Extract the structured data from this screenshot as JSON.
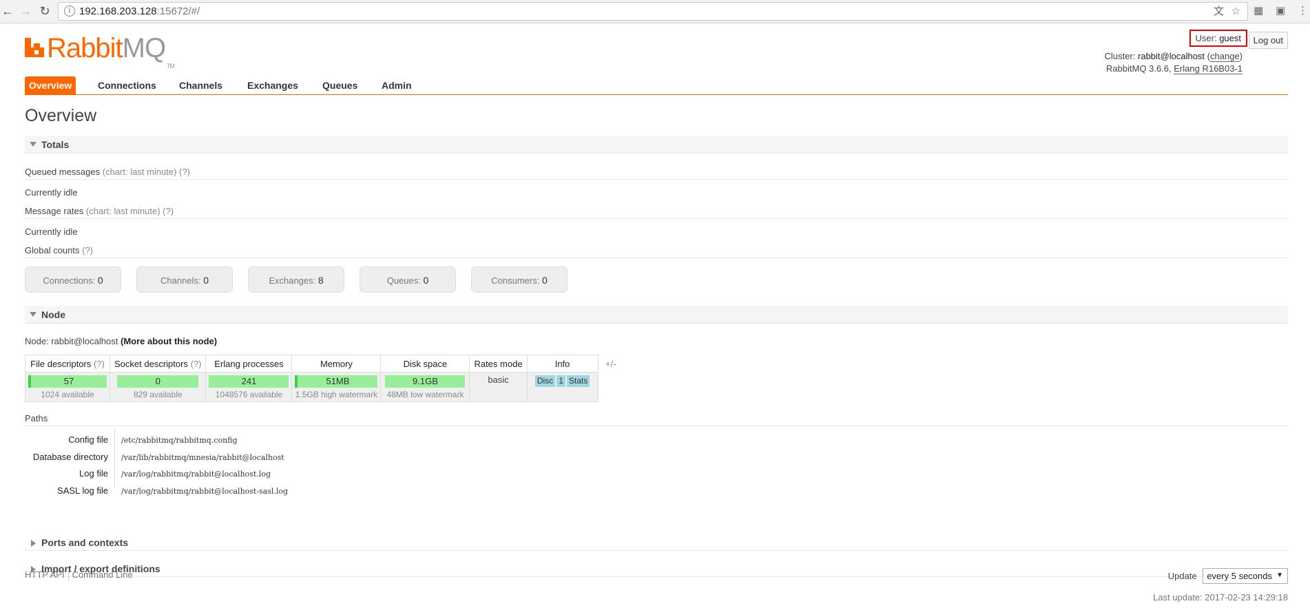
{
  "browser": {
    "url_host": "192.168.203.128",
    "url_rest": ":15672/#/"
  },
  "logo": {
    "rabbit": "Rabbit",
    "mq": "MQ",
    "tm": "TM"
  },
  "header": {
    "user_label": "User:",
    "user_value": "guest",
    "logout_label": "Log out",
    "cluster_label": "Cluster:",
    "cluster_value": "rabbit@localhost",
    "change_label": "change",
    "version_text": "RabbitMQ 3.6.6,",
    "erlang_label": "Erlang R16B03-1"
  },
  "tabs": [
    {
      "label": "Overview",
      "active": true
    },
    {
      "label": "Connections"
    },
    {
      "label": "Channels"
    },
    {
      "label": "Exchanges"
    },
    {
      "label": "Queues"
    },
    {
      "label": "Admin"
    }
  ],
  "page_title": "Overview",
  "totals": {
    "title": "Totals",
    "queued_messages": "Queued messages",
    "queued_hint": "(chart: last minute) (?)",
    "idle_1": "Currently idle",
    "message_rates": "Message rates",
    "rates_hint": "(chart: last minute) (?)",
    "idle_2": "Currently idle",
    "global_counts": "Global counts",
    "global_hint": "(?)",
    "counts": [
      {
        "label": "Connections:",
        "value": "0"
      },
      {
        "label": "Channels:",
        "value": "0"
      },
      {
        "label": "Exchanges:",
        "value": "8"
      },
      {
        "label": "Queues:",
        "value": "0"
      },
      {
        "label": "Consumers:",
        "value": "0"
      }
    ]
  },
  "node": {
    "title": "Node",
    "node_label": "Node:",
    "node_value": "rabbit@localhost",
    "more_link": "(More about this node)",
    "columns": {
      "file_descriptors": "File descriptors",
      "socket_descriptors": "Socket descriptors",
      "erlang_processes": "Erlang processes",
      "memory": "Memory",
      "disk_space": "Disk space",
      "rates_mode": "Rates mode",
      "info": "Info",
      "help": "(?)"
    },
    "values": {
      "file_descriptors": "57",
      "file_descriptors_avail": "1024 available",
      "socket_descriptors": "0",
      "socket_descriptors_avail": "829 available",
      "erlang_processes": "241",
      "erlang_processes_avail": "1048576 available",
      "memory": "51MB",
      "memory_watermark": "1.5GB high watermark",
      "disk_space": "9.1GB",
      "disk_watermark": "48MB low watermark",
      "rates_mode": "basic",
      "info_badges": [
        "Disc",
        "1",
        "Stats"
      ]
    },
    "plus_minus": "+/-"
  },
  "paths": {
    "title": "Paths",
    "rows": [
      {
        "key": "Config file",
        "value": "/etc/rabbitmq/rabbitmq.config"
      },
      {
        "key": "Database directory",
        "value": "/var/lib/rabbitmq/mnesia/rabbit@localhost"
      },
      {
        "key": "Log file",
        "value": "/var/log/rabbitmq/rabbit@localhost.log"
      },
      {
        "key": "SASL log file",
        "value": "/var/log/rabbitmq/rabbit@localhost-sasl.log"
      }
    ]
  },
  "sections": {
    "ports": "Ports and contexts",
    "import_export": "Import / export definitions"
  },
  "footer": {
    "http_api": "HTTP API",
    "command_line": "Command Line",
    "update_label": "Update",
    "update_value": "every 5 seconds",
    "last_update": "Last update: 2017-02-23 14:29:18"
  }
}
